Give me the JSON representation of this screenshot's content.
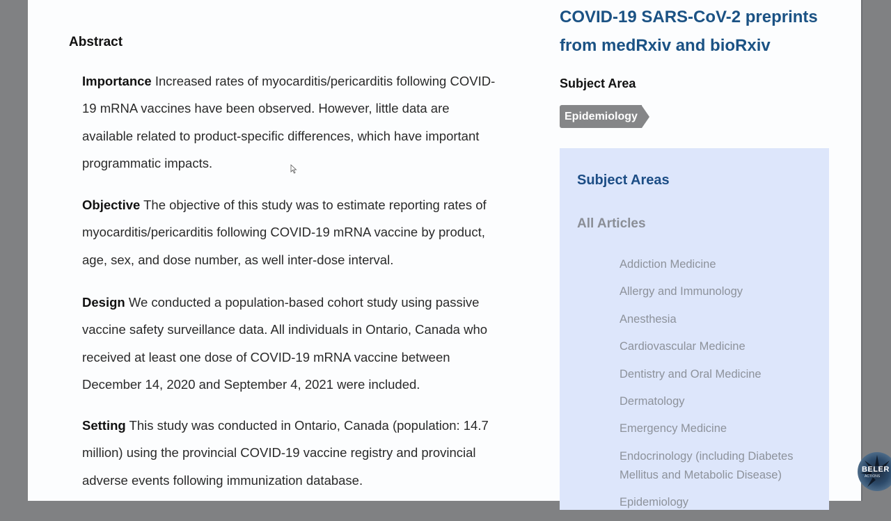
{
  "abstract": {
    "heading": "Abstract",
    "sections": [
      {
        "label": "Importance",
        "text": "Increased rates of myocarditis/pericarditis following COVID-19 mRNA vaccines have been observed. However, little data are available related to product-specific differences, which have important programmatic impacts."
      },
      {
        "label": "Objective",
        "text": "The objective of this study was to estimate reporting rates of myocarditis/pericarditis following COVID-19 mRNA vaccine by product, age, sex, and dose number, as well inter-dose interval."
      },
      {
        "label": "Design",
        "text": "We conducted a population-based cohort study using passive vaccine safety surveillance data. All individuals in Ontario, Canada who received at least one dose of COVID-19 mRNA vaccine between December 14, 2020 and September 4, 2021 were included."
      },
      {
        "label": "Setting",
        "text": "This study was conducted in Ontario, Canada (population: 14.7 million) using the provincial COVID-19 vaccine registry and provincial adverse events following immunization database."
      }
    ]
  },
  "sidebar": {
    "collection_title": "COVID-19 SARS-CoV-2 preprints from medRxiv and bioRxiv",
    "subject_area_label": "Subject Area",
    "subject_tag": "Epidemiology",
    "panel": {
      "heading": "Subject Areas",
      "all_articles": "All Articles",
      "items": [
        "Addiction Medicine",
        "Allergy and Immunology",
        "Anesthesia",
        "Cardiovascular Medicine",
        "Dentistry and Oral Medicine",
        "Dermatology",
        "Emergency Medicine",
        "Endocrinology (including Diabetes Mellitus and Metabolic Disease)",
        "Epidemiology"
      ]
    }
  },
  "overlay": {
    "logo_text": "BELER",
    "logo_subtext": "ACTIONS"
  },
  "colors": {
    "title_blue": "#1b5284",
    "panel_bg": "#dde6fb",
    "tag_gray": "#858688"
  }
}
